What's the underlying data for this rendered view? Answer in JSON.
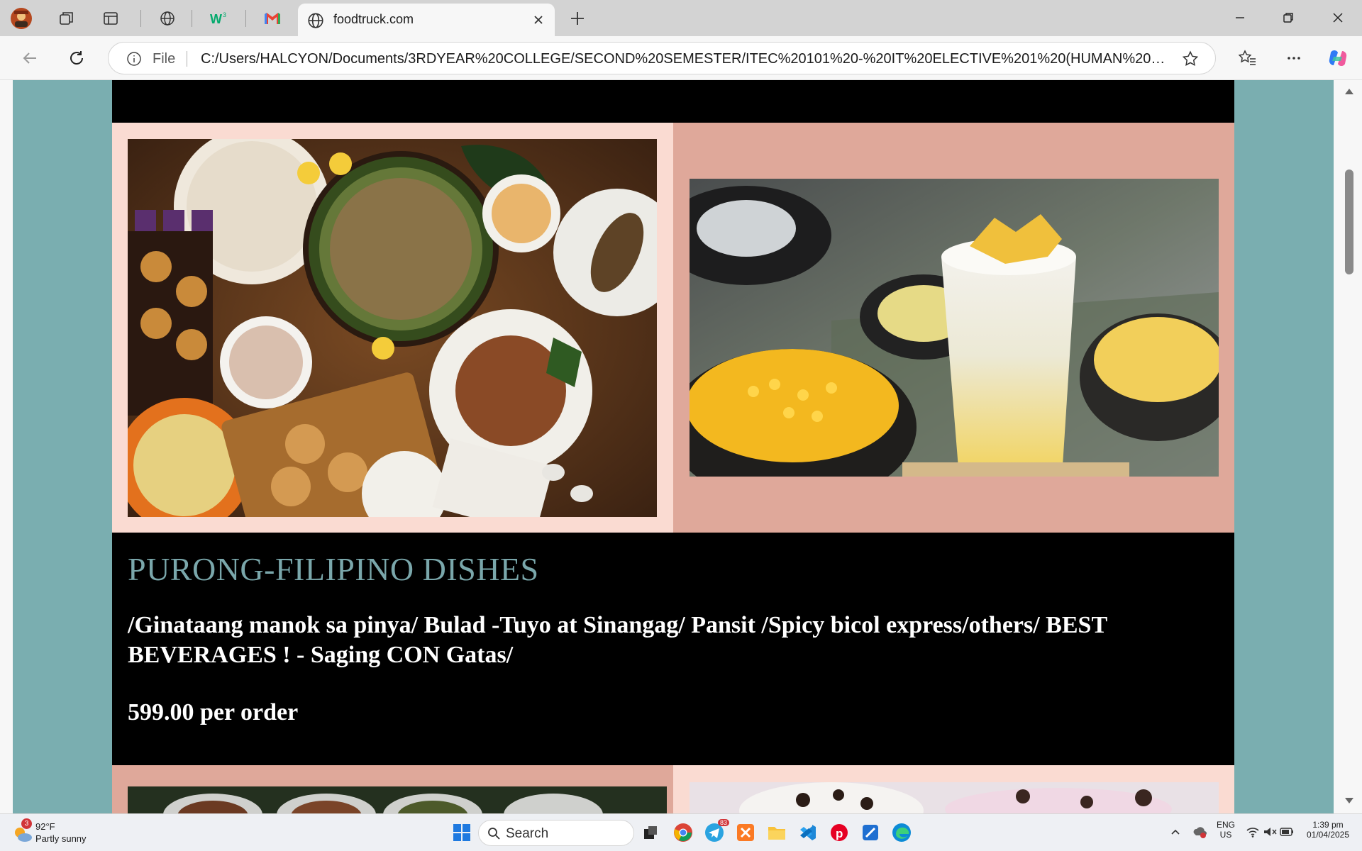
{
  "browser": {
    "tab_title": "foodtruck.com",
    "address_scheme_label": "File",
    "url": "C:/Users/HALCYON/Documents/3RDYEAR%20COLLEGE/SECOND%20SEMESTER/ITEC%20101%20-%20IT%20ELECTIVE%201%20(HUMAN%20CO..."
  },
  "page": {
    "section_title": "PURONG-FILIPINO DISHES",
    "items_text": "/Ginataang manok sa pinya/ Bulad -Tuyo at Sinangag/ Pansit /Spicy bicol express/others/ BEST BEVERAGES ! - Saging CON Gatas/",
    "price_text": "599.00 per order",
    "colors": {
      "teal_background": "#7aaeb0",
      "light_pink": "#fadbd2",
      "dusty_pink": "#dfa89a",
      "title_teal": "#7aa7ab"
    }
  },
  "taskbar": {
    "weather_badge": "3",
    "temperature": "92°F",
    "weather_condition": "Partly sunny",
    "search_label": "Search",
    "telegram_badge": "83",
    "language_line1": "ENG",
    "language_line2": "US",
    "time": "1:39 pm",
    "date": "01/04/2025"
  },
  "icons": [
    "profile-avatar-icon",
    "workspaces-icon",
    "tab-actions-icon",
    "globe-icon",
    "w3schools-icon",
    "gmail-icon",
    "new-tab-icon",
    "back-icon",
    "refresh-icon",
    "info-icon",
    "favorite-star-icon",
    "favorites-icon",
    "more-icon",
    "copilot-icon",
    "windows-start-icon",
    "search-icon",
    "task-view-icon",
    "chrome-icon",
    "telegram-icon",
    "xampp-icon",
    "file-explorer-icon",
    "vscode-icon",
    "pinterest-icon",
    "blue-app-icon",
    "edge-icon"
  ]
}
